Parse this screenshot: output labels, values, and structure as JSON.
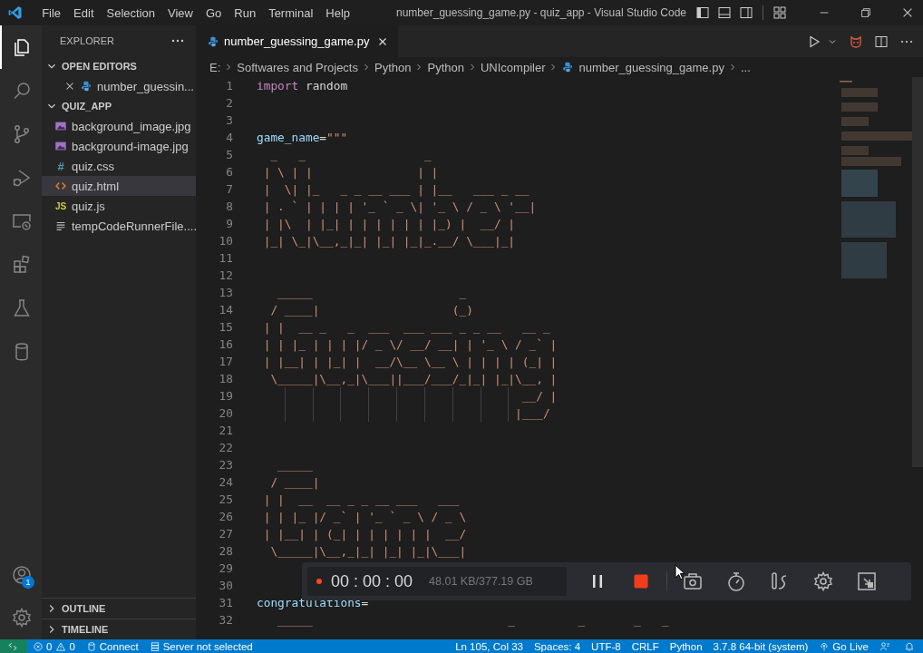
{
  "title_bar": {
    "menu": [
      "File",
      "Edit",
      "Selection",
      "View",
      "Go",
      "Run",
      "Terminal",
      "Help"
    ],
    "title": "number_guessing_game.py - quiz_app - Visual Studio Code"
  },
  "activity_bar": [
    {
      "kind": "files",
      "selected": true
    },
    {
      "kind": "search",
      "selected": false
    },
    {
      "kind": "source-control",
      "selected": false
    },
    {
      "kind": "run-debug",
      "selected": false
    },
    {
      "kind": "remote",
      "selected": false
    },
    {
      "kind": "extensions",
      "selected": false
    },
    {
      "kind": "testing",
      "selected": false
    },
    {
      "kind": "database",
      "selected": false
    }
  ],
  "account_badge": "1",
  "sidebar": {
    "title": "EXPLORER",
    "sections": [
      {
        "label": "OPEN EDITORS",
        "expanded": true,
        "items": [
          {
            "name": "number_guessin...",
            "kind": "python",
            "selected": false,
            "closable": true
          }
        ]
      },
      {
        "label": "QUIZ_APP",
        "expanded": true,
        "items": [
          {
            "name": "background_image.jpg",
            "kind": "image",
            "selected": false
          },
          {
            "name": "background-image.jpg",
            "kind": "image",
            "selected": false
          },
          {
            "name": "quiz.css",
            "kind": "css",
            "glyph": "#",
            "selected": false
          },
          {
            "name": "quiz.html",
            "kind": "html",
            "selected": true
          },
          {
            "name": "quiz.js",
            "kind": "js",
            "glyph": "JS",
            "selected": false
          },
          {
            "name": "tempCodeRunnerFile....",
            "kind": "text",
            "selected": false
          }
        ]
      }
    ],
    "bottom_sections": [
      {
        "label": "OUTLINE",
        "expanded": false
      },
      {
        "label": "TIMELINE",
        "expanded": false
      }
    ]
  },
  "tabs": [
    {
      "label": "number_guessing_game.py",
      "selected": true
    }
  ],
  "breadcrumbs": [
    {
      "text": "E:"
    },
    {
      "text": "Softwares and Projects"
    },
    {
      "text": "Python"
    },
    {
      "text": "Python"
    },
    {
      "text": "UNIcompiler"
    },
    {
      "text": "number_guessing_game.py",
      "kind": "python"
    },
    {
      "text": "..."
    }
  ],
  "code": [
    {
      "n": "1",
      "tokens": [
        {
          "kind": "keyword",
          "text": "import"
        },
        {
          "kind": "plain",
          "text": " random"
        }
      ]
    },
    {
      "n": "2"
    },
    {
      "n": "3"
    },
    {
      "n": "4",
      "tokens": [
        {
          "kind": "variable",
          "text": "game_name"
        },
        {
          "kind": "plain",
          "text": "="
        },
        {
          "kind": "string",
          "text": "\"\"\""
        }
      ]
    },
    {
      "n": "5",
      "tokens": [
        {
          "kind": "string",
          "text": "  _   _                 _"
        }
      ]
    },
    {
      "n": "6",
      "tokens": [
        {
          "kind": "string",
          "text": " | \\ | |               | |"
        }
      ]
    },
    {
      "n": "7",
      "tokens": [
        {
          "kind": "string",
          "text": " |  \\| |_   _ _ __ ___ | |__   ___ _ __"
        }
      ]
    },
    {
      "n": "8",
      "tokens": [
        {
          "kind": "string",
          "text": " | . ` | | | | '_ ` _ \\| '_ \\ / _ \\ '__|"
        }
      ]
    },
    {
      "n": "9",
      "tokens": [
        {
          "kind": "string",
          "text": " | |\\  | |_| | | | | | | |_) |  __/ |"
        }
      ]
    },
    {
      "n": "10",
      "tokens": [
        {
          "kind": "string",
          "text": " |_| \\_|\\__,_|_| |_| |_|_.__/ \\___|_|"
        }
      ]
    },
    {
      "n": "11"
    },
    {
      "n": "12"
    },
    {
      "n": "13",
      "tokens": [
        {
          "kind": "string",
          "text": "   _____                     _"
        }
      ]
    },
    {
      "n": "14",
      "tokens": [
        {
          "kind": "string",
          "text": "  / ____|                   (_)"
        }
      ]
    },
    {
      "n": "15",
      "tokens": [
        {
          "kind": "string",
          "text": " | |  __ _   _  ___  ___ ___ _ _ __   __ _"
        }
      ]
    },
    {
      "n": "16",
      "tokens": [
        {
          "kind": "string",
          "text": " | | |_ | | | |/ _ \\/ __/ __| | '_ \\ / _` |"
        }
      ]
    },
    {
      "n": "17",
      "tokens": [
        {
          "kind": "string",
          "text": " | |__| | |_| |  __/\\__ \\__ \\ | | | | (_| |"
        }
      ]
    },
    {
      "n": "18",
      "tokens": [
        {
          "kind": "string",
          "text": "  \\_____|\\__,_|\\___||___/___/_|_| |_|\\__, |"
        }
      ]
    },
    {
      "n": "19",
      "tokens": [
        {
          "kind": "string",
          "text": "                                      __/ |"
        }
      ]
    },
    {
      "n": "20",
      "tokens": [
        {
          "kind": "string",
          "text": "                                     |___/"
        }
      ]
    },
    {
      "n": "21"
    },
    {
      "n": "22"
    },
    {
      "n": "23",
      "tokens": [
        {
          "kind": "string",
          "text": "   _____"
        }
      ]
    },
    {
      "n": "24",
      "tokens": [
        {
          "kind": "string",
          "text": "  / ____|"
        }
      ]
    },
    {
      "n": "25",
      "tokens": [
        {
          "kind": "string",
          "text": " | |  __  __ _ _ __ ___   ___"
        }
      ]
    },
    {
      "n": "26",
      "tokens": [
        {
          "kind": "string",
          "text": " | | |_ |/ _` | '_ ` _ \\ / _ \\"
        }
      ]
    },
    {
      "n": "27",
      "tokens": [
        {
          "kind": "string",
          "text": " | |__| | (_| | | | | | |  __/"
        }
      ]
    },
    {
      "n": "28",
      "tokens": [
        {
          "kind": "string",
          "text": "  \\_____|\\__,_|_| |_| |_|\\___|"
        }
      ]
    },
    {
      "n": "29"
    },
    {
      "n": "30"
    },
    {
      "n": "31",
      "tokens": [
        {
          "kind": "variable",
          "text": "congratulations"
        },
        {
          "kind": "plain",
          "text": "="
        }
      ]
    },
    {
      "n": "32",
      "tokens": [
        {
          "kind": "string",
          "text": "   _____                            _         _       _   _"
        }
      ]
    }
  ],
  "recorder": {
    "recording": true,
    "time": "00 : 00 : 00",
    "size": "48.01 KB/377.19 GB"
  },
  "status_bar": {
    "errors": "0",
    "warnings": "0",
    "left": [
      {
        "kind": "plug",
        "text": "Connect"
      },
      {
        "kind": "server",
        "text": "Server not selected"
      }
    ],
    "right": [
      {
        "text": "Ln 105, Col 33"
      },
      {
        "text": "Spaces: 4"
      },
      {
        "text": "UTF-8"
      },
      {
        "text": "CRLF"
      },
      {
        "text": "Python"
      },
      {
        "text": "3.7.8 64-bit (system)"
      },
      {
        "kind": "broadcast",
        "text": "Go Live"
      }
    ]
  }
}
